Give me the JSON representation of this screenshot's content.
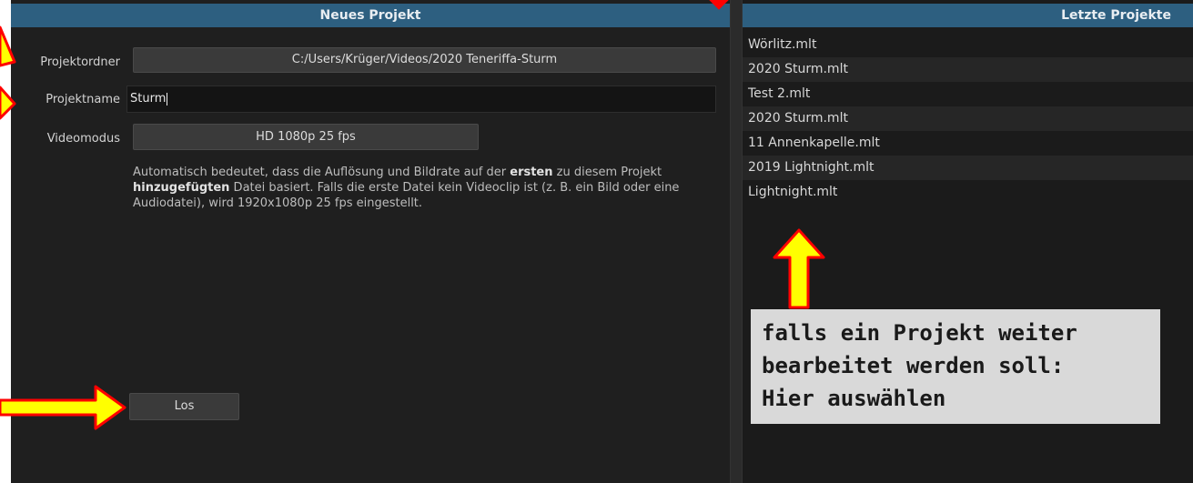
{
  "new_project": {
    "header": "Neues Projekt",
    "folder_label": "Projektordner",
    "folder_value": "C:/Users/Krüger/Videos/2020 Teneriffa-Sturm",
    "name_label": "Projektname",
    "name_value": "Sturm",
    "video_mode_label": "Videomodus",
    "video_mode_value": "HD 1080p 25 fps",
    "help": {
      "t1": "Automatisch bedeutet, dass die Auflösung und Bildrate auf der ",
      "b1": "ersten",
      "t2": " zu diesem Projekt ",
      "b2": "hinzugefügten",
      "t3": " Datei basiert. Falls die erste Datei kein Videoclip ist (z. B. ein Bild oder eine Audiodatei), wird 1920x1080p 25 fps eingestellt."
    },
    "go_button": "Los"
  },
  "recent_projects": {
    "header": "Letzte Projekte",
    "items": [
      "Wörlitz.mlt",
      "2020 Sturm.mlt",
      "Test 2.mlt",
      "2020 Sturm.mlt",
      "11 Annenkapelle.mlt",
      "2019 Lightnight.mlt",
      "Lightnight.mlt"
    ]
  },
  "annotation": {
    "line1": "falls ein Projekt weiter",
    "line2": "bearbeitet werden soll:",
    "line3": "Hier auswählen"
  },
  "colors": {
    "header_bar": "#2d5f80",
    "panel_bg": "#1f1f1f",
    "arrow_fill": "#ffff00",
    "arrow_stroke": "#ff0000",
    "callout_bg": "#d9d9d9"
  }
}
